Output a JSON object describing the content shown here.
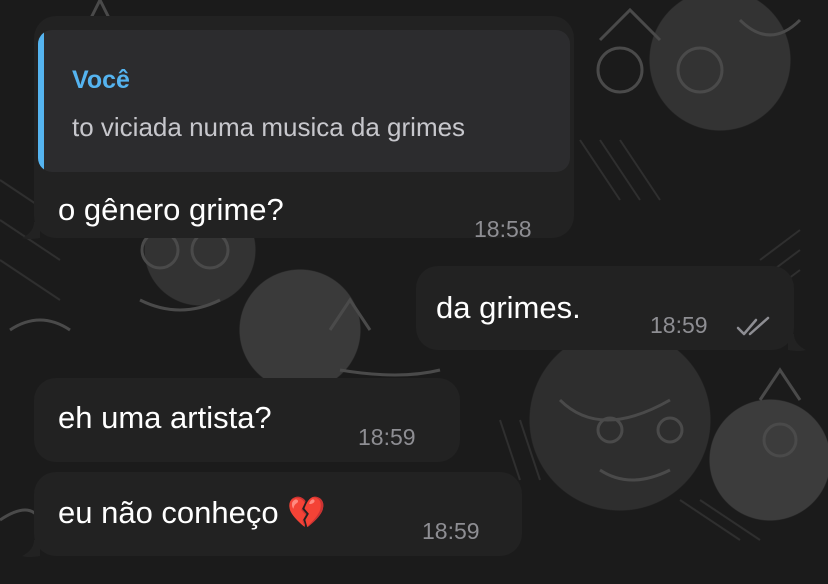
{
  "messages": [
    {
      "direction": "incoming",
      "reply": {
        "author": "Você",
        "text": "to viciada numa musica da grimes"
      },
      "text": "o gênero grime?",
      "time": "18:58"
    },
    {
      "direction": "outgoing",
      "text": "da grimes.",
      "time": "18:59",
      "status": "read"
    },
    {
      "direction": "incoming",
      "text": "eh uma artista?",
      "time": "18:59"
    },
    {
      "direction": "incoming",
      "text": "eu não conheço 💔",
      "time": "18:59"
    }
  ],
  "colors": {
    "bubble": "#222222",
    "reply_accent": "#55b4f0",
    "timestamp": "#8e8e93",
    "text": "#ffffff"
  },
  "icons": {
    "read_status": "double-check-icon",
    "emoji": "broken-heart-emoji"
  }
}
